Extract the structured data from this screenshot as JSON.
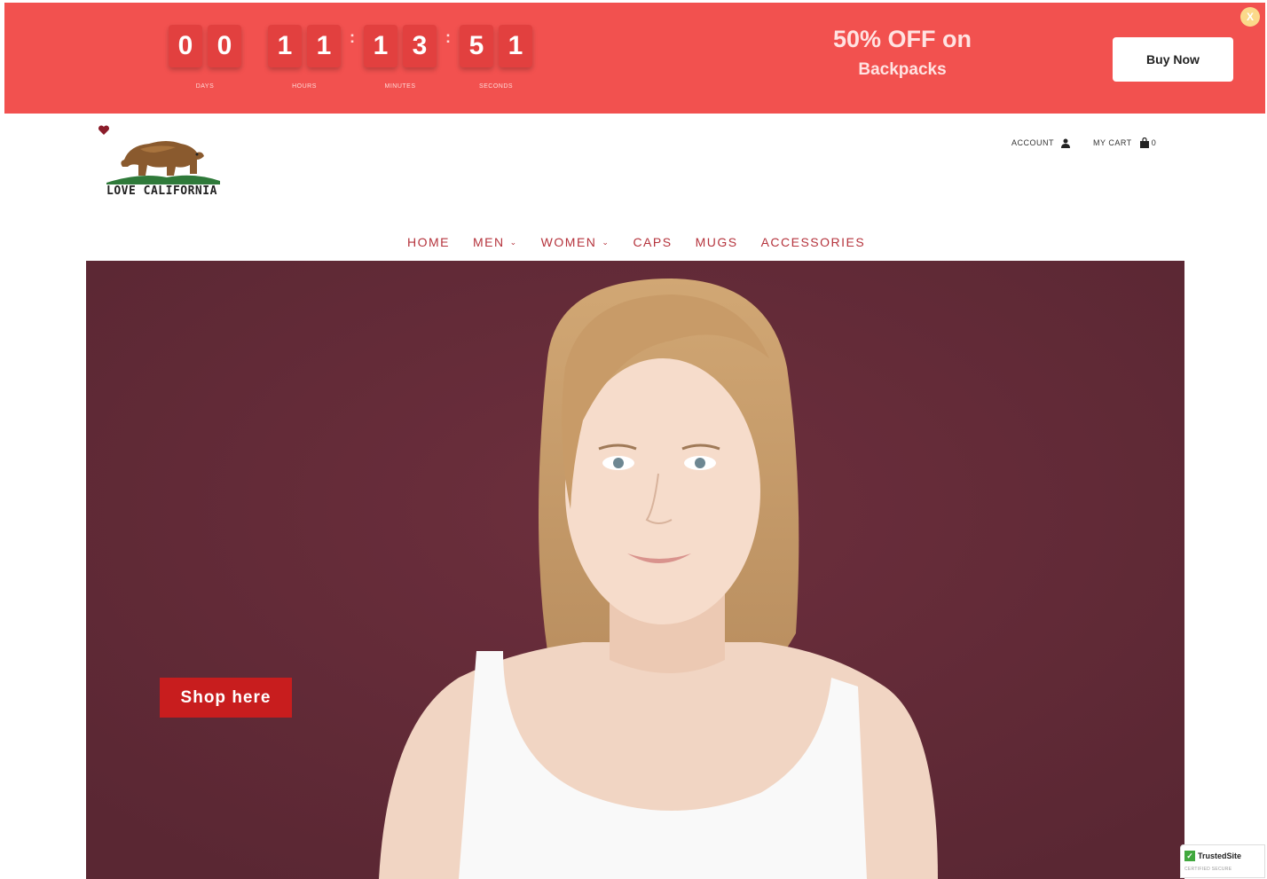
{
  "promo": {
    "countdown": {
      "days": [
        "0",
        "0"
      ],
      "hours": [
        "1",
        "1"
      ],
      "minutes": [
        "1",
        "3"
      ],
      "seconds": [
        "5",
        "1"
      ],
      "labels": {
        "days": "DAYS",
        "hours": "HOURS",
        "minutes": "MINUTES",
        "seconds": "SECONDS"
      },
      "separator": ":"
    },
    "offer_title": "50% OFF on",
    "offer_subtitle": "Backpacks",
    "buy_label": "Buy Now",
    "close_label": "X",
    "colors": {
      "bar": "#f2514f",
      "digit": "#e2403f"
    }
  },
  "header": {
    "logo_text": "LOVE CALIFORNIA",
    "account_label": "ACCOUNT",
    "cart_label": "MY CART",
    "cart_count": "0"
  },
  "nav": {
    "items": [
      {
        "label": "HOME",
        "dropdown": false
      },
      {
        "label": "MEN",
        "dropdown": true
      },
      {
        "label": "WOMEN",
        "dropdown": true
      },
      {
        "label": "CAPS",
        "dropdown": false
      },
      {
        "label": "MUGS",
        "dropdown": false
      },
      {
        "label": "ACCESSORIES",
        "dropdown": false
      }
    ]
  },
  "hero": {
    "cta_label": "Shop here",
    "colors": {
      "background": "#642b38",
      "cta": "#c81d1e"
    }
  },
  "badge": {
    "name": "TrustedSite",
    "sub": "CERTIFIED SECURE"
  }
}
